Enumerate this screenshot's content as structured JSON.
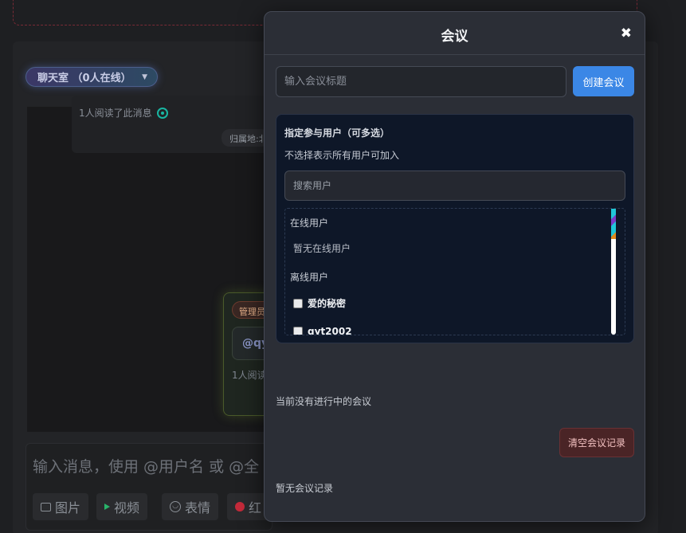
{
  "background": {
    "room_selector": "聊天室 （0人在线）",
    "read_notice": "1人阅读了此消息",
    "location_chip": "归属地:北",
    "admin_badge": "管理员",
    "mention_preview": "@qy",
    "admin_read_notice": "1人阅读",
    "composer_placeholder": "输入消息，使用 @用户名 或 @全",
    "tools": {
      "image": "图片",
      "video": "视频",
      "emoji": "表情",
      "red_packet": "红"
    }
  },
  "modal": {
    "title": "会议",
    "close_glyph": "✖",
    "title_placeholder": "输入会议标题",
    "create_button": "创建会议",
    "participants": {
      "heading": "指定参与用户（可多选）",
      "hint": "不选择表示所有用户可加入",
      "search_placeholder": "搜索用户",
      "online_label": "在线用户",
      "online_empty": "暂无在线用户",
      "offline_label": "离线用户",
      "offline_users": [
        "爱的秘密",
        "qyt2002"
      ]
    },
    "no_active_meeting": "当前没有进行中的会议",
    "clear_button": "清空会议记录",
    "no_records": "暂无会议记录"
  },
  "colors": {
    "accent": "#3b87e6",
    "danger_bg": "#4a2426",
    "modal_bg": "#2b2e36",
    "list_bg": "#0e1728"
  }
}
